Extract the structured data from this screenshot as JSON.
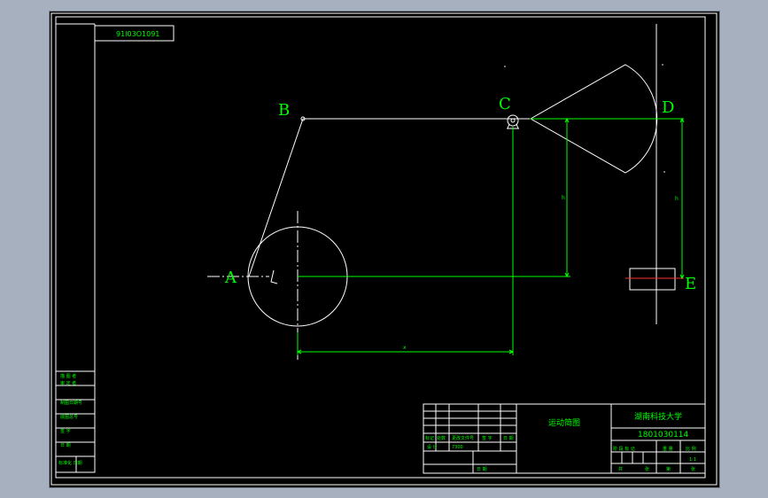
{
  "drawing": {
    "code_stamp": "91I03O1091",
    "points": {
      "A": "A",
      "B": "B",
      "C": "C",
      "D": "D",
      "E": "E"
    },
    "dims": {
      "x": "x",
      "h1": "h",
      "h2": "h"
    }
  },
  "title_block": {
    "drawing_title": "运动简图",
    "school": "湖南科技大学",
    "drawing_number": "1801030114",
    "scale": "1:1",
    "left_rows": [
      "描 图 者",
      "审 定 者",
      "制图日期号",
      "底图总号",
      "签 字",
      "日 期",
      "标准化 日期"
    ],
    "revision_labels": [
      "标记",
      "处数",
      "更改文件号",
      "签 字",
      "日 期"
    ],
    "designer_row": [
      "设 计",
      "7300"
    ],
    "approve_label": "日 期",
    "stage_labels": [
      "阶 段 标 记",
      "重 量",
      "比 例"
    ],
    "sheet_labels": [
      "共",
      "张",
      "第",
      "张"
    ]
  },
  "colors": {
    "background": "#000000",
    "geometry": "#ffffff",
    "annotation": "#00ff00",
    "axis": "#ff3030",
    "app_frame": "#a6b0bf"
  }
}
